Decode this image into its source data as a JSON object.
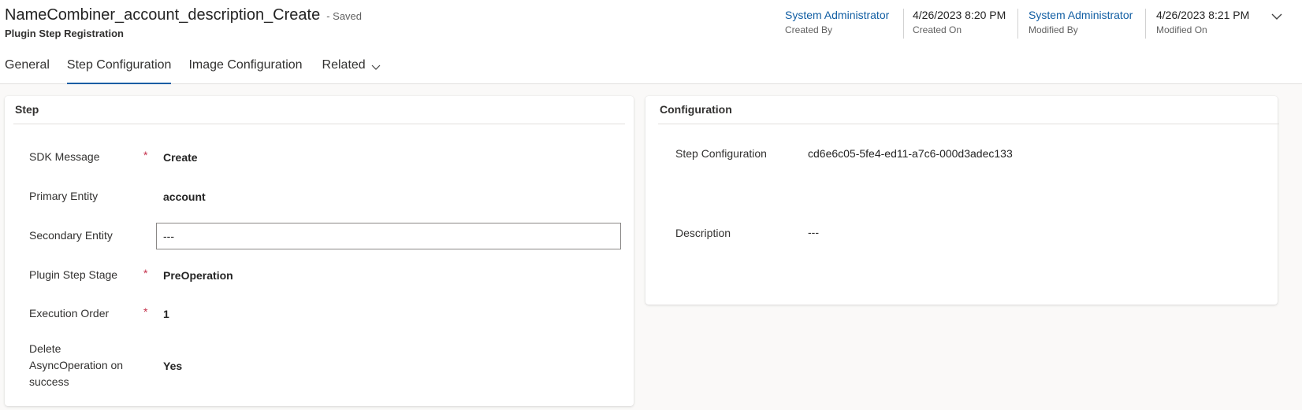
{
  "header": {
    "record_title": "NameCombiner_account_description_Create",
    "save_status": "- Saved",
    "entity_type": "Plugin Step Registration",
    "created_by": {
      "value": "System Administrator",
      "label": "Created By"
    },
    "created_on": {
      "value": "4/26/2023 8:20 PM",
      "label": "Created On"
    },
    "modified_by": {
      "value": "System Administrator",
      "label": "Modified By"
    },
    "modified_on": {
      "value": "4/26/2023 8:21 PM",
      "label": "Modified On"
    },
    "expand_icon": "chevron-down-icon"
  },
  "tabs": [
    {
      "label": "General",
      "selected": false
    },
    {
      "label": "Step Configuration",
      "selected": true
    },
    {
      "label": "Image Configuration",
      "selected": false
    },
    {
      "label": "Related",
      "selected": false,
      "has_dropdown": true
    }
  ],
  "step_section": {
    "title": "Step",
    "fields": [
      {
        "label": "SDK Message",
        "required": "*",
        "value": "Create"
      },
      {
        "label": "Primary Entity",
        "value": "account"
      },
      {
        "label": "Secondary Entity",
        "value": "---"
      },
      {
        "label": "Plugin Step Stage",
        "required": "*",
        "value": "PreOperation"
      },
      {
        "label": "Execution Order",
        "required": "*",
        "value": "1"
      },
      {
        "label_line1": "Delete",
        "label_line2": "AsyncOperation on",
        "label_line3": "success",
        "value": "Yes"
      }
    ]
  },
  "configuration_section": {
    "title": "Configuration",
    "fields": [
      {
        "label": "Step Configuration",
        "value": "cd6e6c05-5fe4-ed11-a7c6-000d3adec133"
      },
      {
        "label": "Description",
        "value": "---"
      }
    ]
  },
  "colors": {
    "accent": "#115ea3",
    "required": "#c4314b",
    "background": "#faf9f8"
  }
}
